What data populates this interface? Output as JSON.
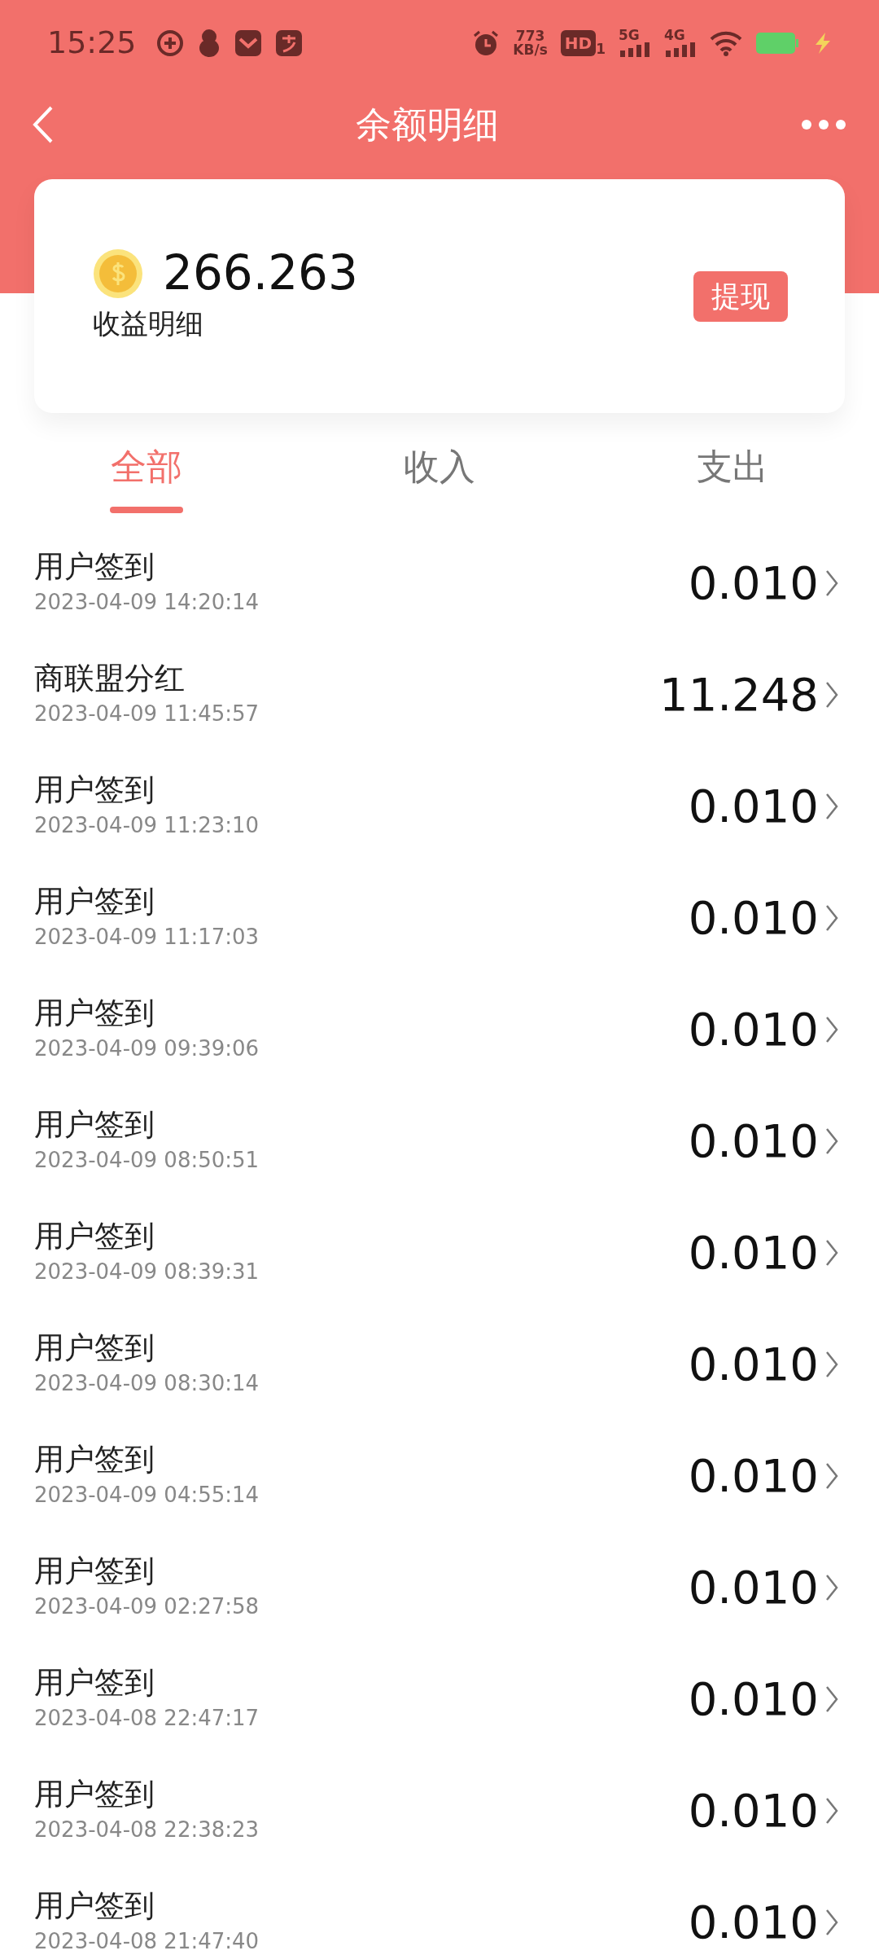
{
  "status_bar": {
    "time": "15:25",
    "speed_value": "773",
    "speed_unit": "KB/s",
    "hd_label": "HD",
    "hd_sub": "1",
    "net_5g": "5G",
    "net_4g": "4G"
  },
  "header": {
    "title": "余额明细"
  },
  "balance_card": {
    "amount": "266.263",
    "label": "收益明细",
    "withdraw_button": "提现"
  },
  "tabs": [
    {
      "label": "全部",
      "selected": true
    },
    {
      "label": "收入",
      "selected": false
    },
    {
      "label": "支出",
      "selected": false
    }
  ],
  "records": [
    {
      "title": "用户签到",
      "time": "2023-04-09 14:20:14",
      "amount": "0.010"
    },
    {
      "title": "商联盟分红",
      "time": "2023-04-09 11:45:57",
      "amount": "11.248"
    },
    {
      "title": "用户签到",
      "time": "2023-04-09 11:23:10",
      "amount": "0.010"
    },
    {
      "title": "用户签到",
      "time": "2023-04-09 11:17:03",
      "amount": "0.010"
    },
    {
      "title": "用户签到",
      "time": "2023-04-09 09:39:06",
      "amount": "0.010"
    },
    {
      "title": "用户签到",
      "time": "2023-04-09 08:50:51",
      "amount": "0.010"
    },
    {
      "title": "用户签到",
      "time": "2023-04-09 08:39:31",
      "amount": "0.010"
    },
    {
      "title": "用户签到",
      "time": "2023-04-09 08:30:14",
      "amount": "0.010"
    },
    {
      "title": "用户签到",
      "time": "2023-04-09 04:55:14",
      "amount": "0.010"
    },
    {
      "title": "用户签到",
      "time": "2023-04-09 02:27:58",
      "amount": "0.010"
    },
    {
      "title": "用户签到",
      "time": "2023-04-08 22:47:17",
      "amount": "0.010"
    },
    {
      "title": "用户签到",
      "time": "2023-04-08 22:38:23",
      "amount": "0.010"
    },
    {
      "title": "用户签到",
      "time": "2023-04-08 21:47:40",
      "amount": "0.010"
    }
  ]
}
